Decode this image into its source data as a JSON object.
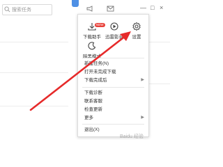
{
  "search": {
    "placeholder": "搜索任务"
  },
  "window_controls": {
    "minimize": "—",
    "maximize": "□",
    "close": "×"
  },
  "menu": {
    "grid": [
      {
        "label": "下载助手",
        "icon": "download-assistant-icon",
        "badge": "NEW"
      },
      {
        "label": "迅雷影音",
        "icon": "xunlei-player-icon"
      },
      {
        "label": "设置",
        "icon": "gear-icon"
      },
      {
        "label": "暗黑模式",
        "icon": "moon-icon"
      }
    ],
    "items": [
      {
        "label": "新建任务(N)"
      },
      {
        "label": "打开未完成下载"
      },
      {
        "label": "下载完成后",
        "has_submenu": true
      },
      {
        "label": "下载诊断"
      },
      {
        "label": "联系客服"
      },
      {
        "label": "检查更新"
      },
      {
        "label": "更多",
        "has_submenu": true
      },
      {
        "label": "退出(X)"
      }
    ]
  },
  "watermark": "Baidu 经验",
  "colors": {
    "accent": "#2f7de1",
    "arrow": "#e62a2a",
    "badge": "#e8413a"
  }
}
